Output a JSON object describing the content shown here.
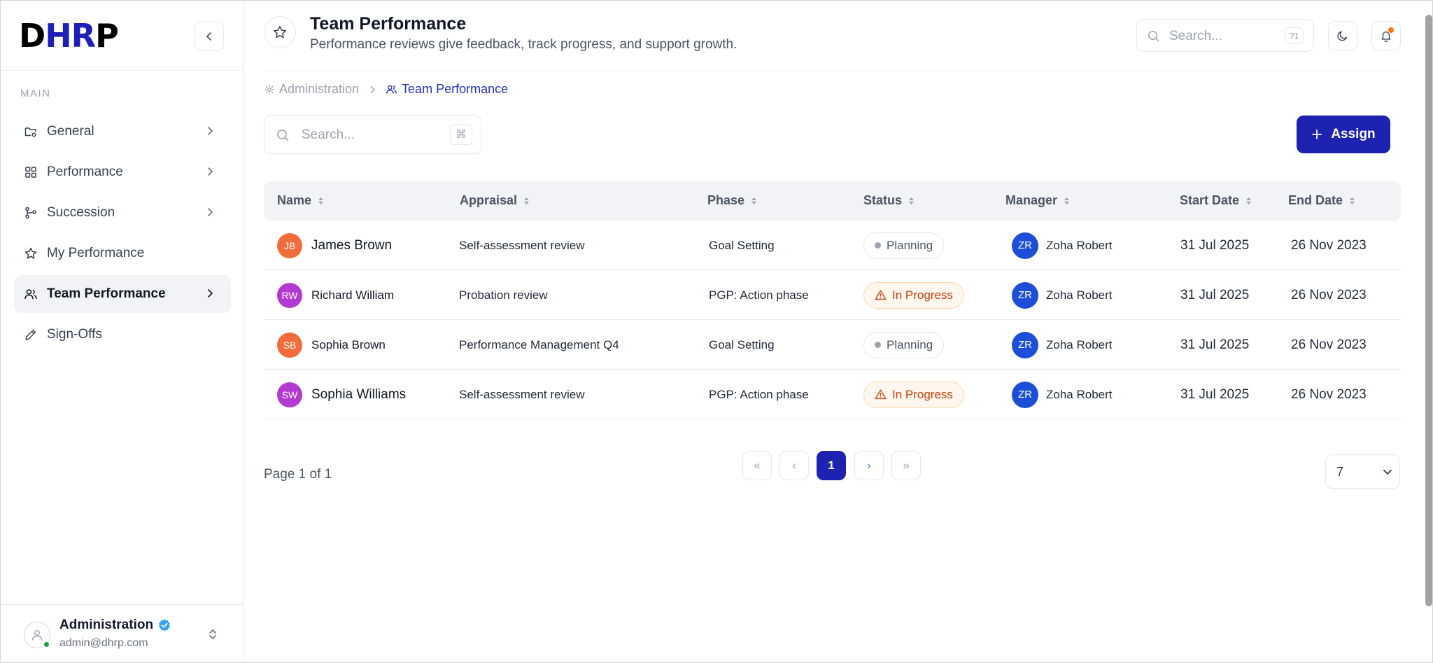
{
  "app": {
    "logo_part1": "D",
    "logo_part2": "HR",
    "logo_part3": "P"
  },
  "sidebar": {
    "section_label": "MAIN",
    "items": [
      {
        "label": "General",
        "icon": "folder-settings-icon",
        "has_chevron": true
      },
      {
        "label": "Performance",
        "icon": "grid-icon",
        "has_chevron": true
      },
      {
        "label": "Succession",
        "icon": "branch-icon",
        "has_chevron": true
      },
      {
        "label": "My Performance",
        "icon": "star-icon",
        "has_chevron": false
      },
      {
        "label": "Team Performance",
        "icon": "users-icon",
        "has_chevron": true,
        "active": true
      },
      {
        "label": "Sign-Offs",
        "icon": "pen-icon",
        "has_chevron": false
      }
    ]
  },
  "profile": {
    "name": "Administration",
    "email": "admin@dhrp.com"
  },
  "header": {
    "title": "Team Performance",
    "subtitle": "Performance reviews give feedback, track progress, and support growth.",
    "search_placeholder": "Search...",
    "search_shortcut": "?1"
  },
  "breadcrumb": {
    "parent": "Administration",
    "current": "Team Performance"
  },
  "toolbar": {
    "search_placeholder": "Search...",
    "search_shortcut": "⌘",
    "assign_label": "Assign"
  },
  "table": {
    "columns": [
      "Name",
      "Appraisal",
      "Phase",
      "Status",
      "Manager",
      "Start Date",
      "End Date"
    ],
    "rows": [
      {
        "initials": "JB",
        "name": "James Brown",
        "appraisal": "Self-assessment review",
        "phase": "Goal Setting",
        "status": "Planning",
        "manager_initials": "ZR",
        "manager": "Zoha Robert",
        "start": "31 Jul 2025",
        "end": "26 Nov 2023"
      },
      {
        "initials": "RW",
        "name": "Richard William",
        "appraisal": "Probation review",
        "phase": "PGP: Action phase",
        "status": "In Progress",
        "manager_initials": "ZR",
        "manager": "Zoha Robert",
        "start": "31 Jul 2025",
        "end": "26 Nov 2023"
      },
      {
        "initials": "SB",
        "name": "Sophia Brown",
        "appraisal": "Performance Management Q4",
        "phase": "Goal Setting",
        "status": "Planning",
        "manager_initials": "ZR",
        "manager": "Zoha Robert",
        "start": "31 Jul 2025",
        "end": "26 Nov 2023"
      },
      {
        "initials": "SW",
        "name": "Sophia Williams",
        "appraisal": "Self-assessment review",
        "phase": "PGP: Action phase",
        "status": "In Progress",
        "manager_initials": "ZR",
        "manager": "Zoha Robert",
        "start": "31 Jul 2025",
        "end": "26 Nov 2023"
      }
    ]
  },
  "pagination": {
    "info": "Page 1 of 1",
    "first": "«",
    "prev": "‹",
    "current": "1",
    "next": "›",
    "last": "»",
    "per_page": "7"
  },
  "colors": {
    "primary": "#1e22b0",
    "avatar_orange": "#f26b3a",
    "avatar_purple": "#b23ad1",
    "manager_blue": "#1d4ed8"
  }
}
